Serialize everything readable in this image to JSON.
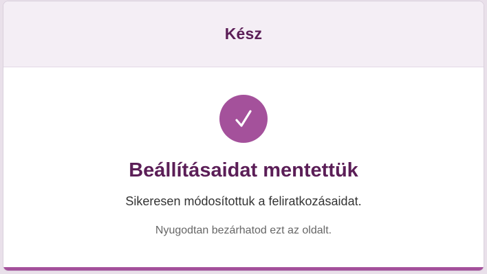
{
  "header": {
    "title": "Kész"
  },
  "status": {
    "icon": "checkmark-icon",
    "icon_color": "#ffffff",
    "circle_color": "#a4519b",
    "headline": "Beállításaidat mentettük",
    "message": "Sikeresen módosítottuk a feliratkozásaidat.",
    "note": "Nyugodtan bezárhatod ezt az oldalt."
  },
  "theme": {
    "accent": "#a4519b",
    "heading_color": "#5b1e57",
    "header_background": "#f4eef5"
  }
}
